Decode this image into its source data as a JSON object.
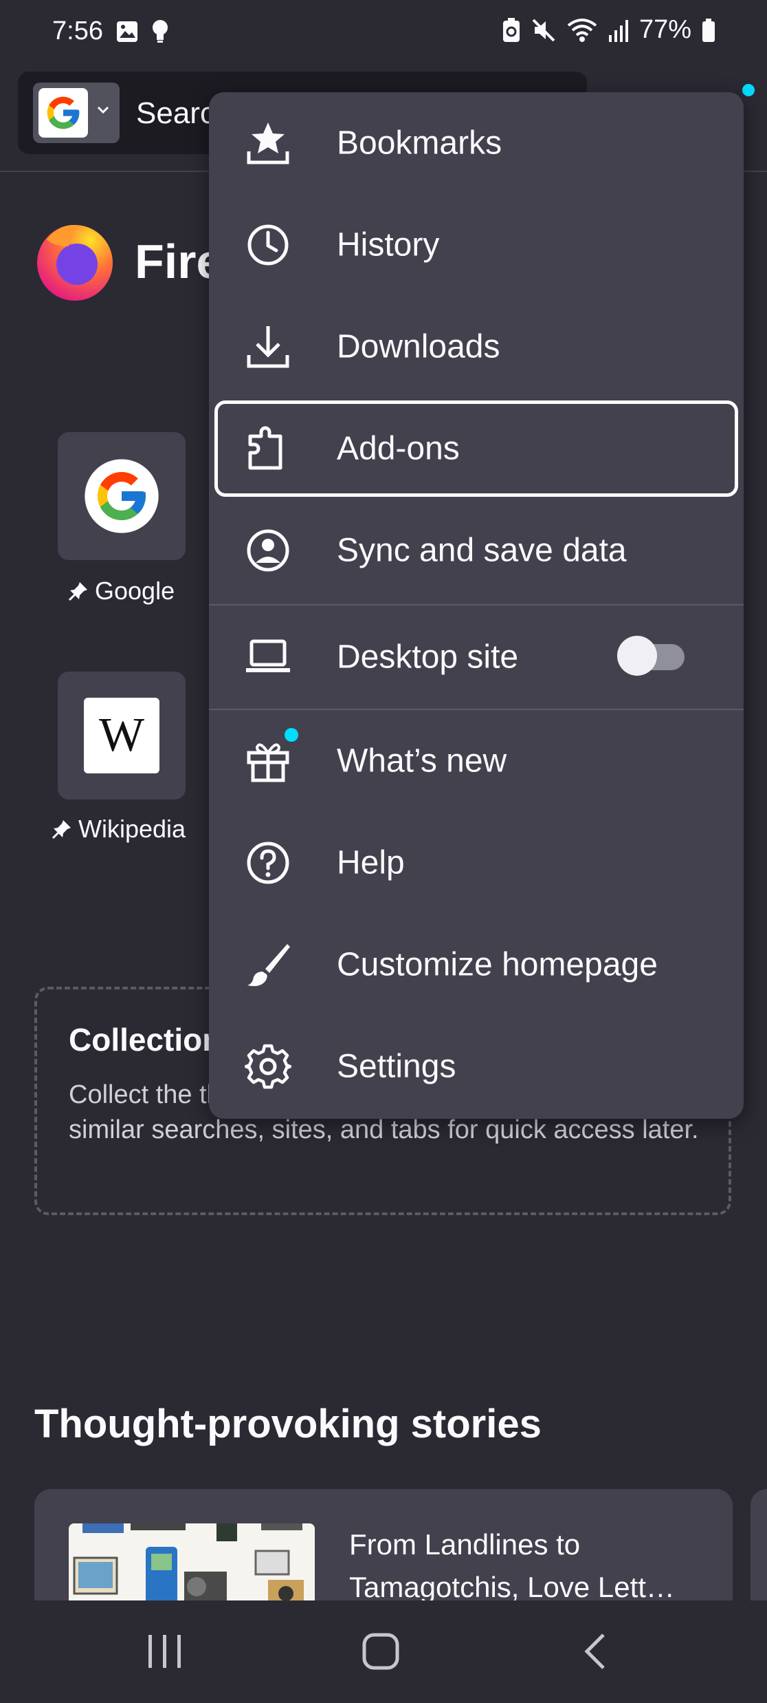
{
  "status_bar": {
    "time": "7:56",
    "battery": "77%"
  },
  "toolbar": {
    "search_placeholder": "Search or enter address"
  },
  "homepage": {
    "brand": "Firefox",
    "shortcuts": [
      {
        "label": "Google"
      },
      {
        "label": "Wikipedia"
      }
    ],
    "collections": {
      "title": "Collections",
      "description": "Collect the things that matter to you. Group together similar searches, sites, and tabs for quick access later."
    },
    "stories": {
      "title": "Thought-provoking stories",
      "card": {
        "line1": "From Landlines to",
        "line2": "Tamagotchis, Love Lett…"
      }
    }
  },
  "menu": {
    "items": [
      {
        "label": "Bookmarks",
        "icon": "bookmarks-icon"
      },
      {
        "label": "History",
        "icon": "history-icon"
      },
      {
        "label": "Downloads",
        "icon": "downloads-icon"
      },
      {
        "label": "Add-ons",
        "icon": "addons-icon",
        "focused": true
      },
      {
        "label": "Sync and save data",
        "icon": "account-icon"
      },
      {
        "label": "Desktop site",
        "icon": "desktop-icon",
        "toggle": false
      },
      {
        "label": "What’s new",
        "icon": "gift-icon",
        "badge": true
      },
      {
        "label": "Help",
        "icon": "help-icon"
      },
      {
        "label": "Customize homepage",
        "icon": "brush-icon"
      },
      {
        "label": "Settings",
        "icon": "settings-icon"
      }
    ]
  },
  "colors": {
    "background": "#2b2a33",
    "menu": "#42414d",
    "accent_dot": "#00ddff"
  }
}
